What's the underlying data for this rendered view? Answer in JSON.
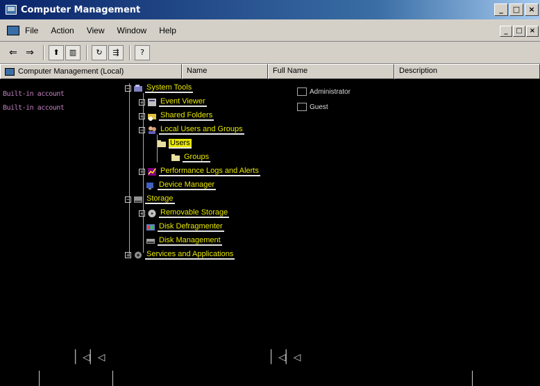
{
  "window": {
    "title": "Computer Management",
    "controls": [
      "_",
      "□",
      "×"
    ]
  },
  "menu": {
    "items": [
      "File",
      "Action",
      "View",
      "Window",
      "Help"
    ],
    "mdi_controls": [
      "_",
      "□",
      "×"
    ]
  },
  "toolbar": {
    "buttons": [
      {
        "name": "back-icon",
        "glyph": "⇐"
      },
      {
        "name": "forward-icon",
        "glyph": "⇒"
      },
      {
        "name": "up-one-level-icon",
        "glyph": "⬆"
      },
      {
        "name": "show-hide-tree-icon",
        "glyph": "▥"
      },
      {
        "name": "refresh-icon",
        "glyph": "↻"
      },
      {
        "name": "export-list-icon",
        "glyph": "⇶"
      },
      {
        "name": "help-icon",
        "glyph": "?"
      }
    ]
  },
  "columns": {
    "tree_header": "Computer Management (Local)",
    "name": "Name",
    "full_name": "Full Name",
    "description": "Description"
  },
  "tree": {
    "items": [
      {
        "label": "System Tools",
        "level": 1
      },
      {
        "label": "Event Viewer",
        "level": 2
      },
      {
        "label": "Shared Folders",
        "level": 2
      },
      {
        "label": "Local Users and Groups",
        "level": 2
      },
      {
        "label": "Users",
        "level": 3
      },
      {
        "label": "Groups",
        "level": 3
      },
      {
        "label": "Performance Logs and Alerts",
        "level": 2
      },
      {
        "label": "Device Manager",
        "level": 2
      },
      {
        "label": "Storage",
        "level": 1
      },
      {
        "label": "Removable Storage",
        "level": 2
      },
      {
        "label": "Disk Defragmenter",
        "level": 2
      },
      {
        "label": "Disk Management",
        "level": 2
      },
      {
        "label": "Services and Applications",
        "level": 1
      }
    ]
  },
  "left_labels": [
    "Built-in account",
    "Built-in account"
  ],
  "list": {
    "rows": [
      {
        "name": "Administrator"
      },
      {
        "name": "Guest"
      }
    ]
  },
  "colors": {
    "titlebar_start": "#0a246a",
    "titlebar_end": "#a6caf0",
    "chrome": "#d4d0c8",
    "tree_text": "#e8e800",
    "background": "#000000"
  }
}
